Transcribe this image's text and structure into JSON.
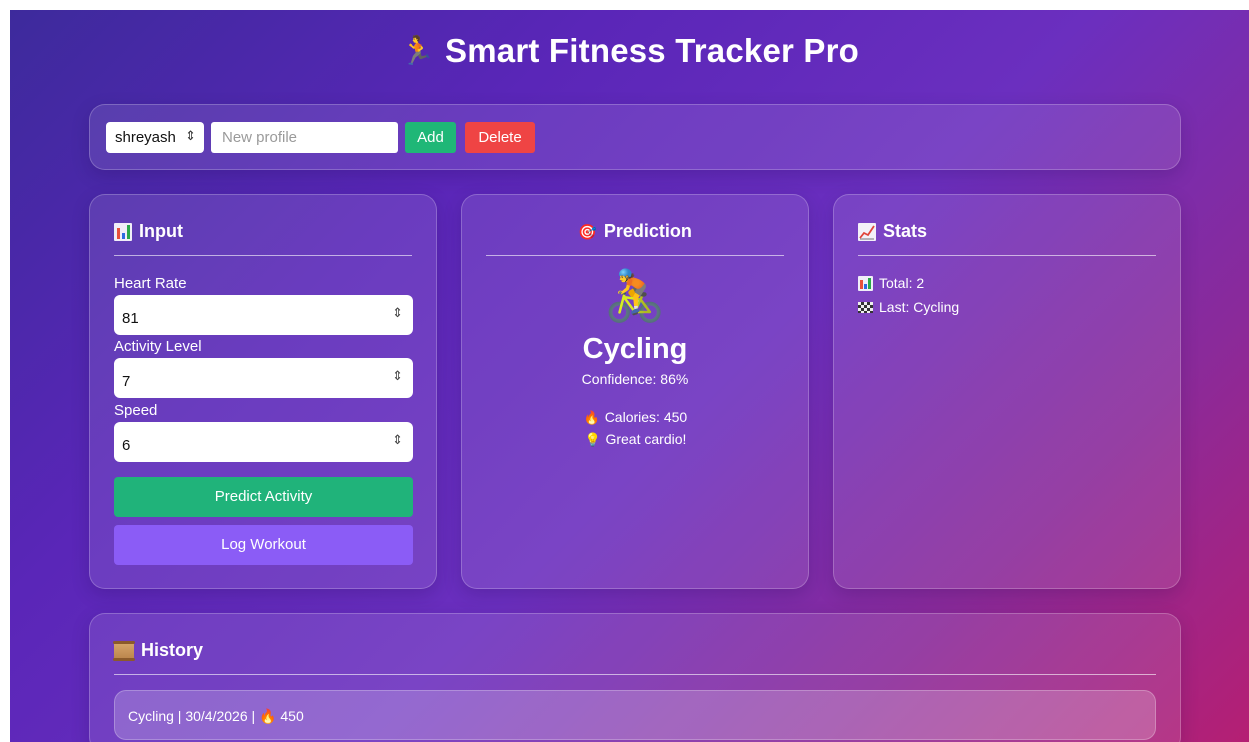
{
  "app": {
    "title": "Smart Fitness Tracker Pro",
    "title_icon": "🏃",
    "colors": {
      "gradient_start": "#3d2a9c",
      "gradient_end": "#b51f73",
      "green": "#1fb777",
      "red": "#ef4444",
      "purple": "#8b5cf6"
    }
  },
  "profile_bar": {
    "selected_profile": "shreyash",
    "new_profile_placeholder": "New profile",
    "new_profile_value": "",
    "add_label": "Add",
    "delete_label": "Delete"
  },
  "input": {
    "heading": "Input",
    "icon": "bar-chart-icon",
    "fields": [
      {
        "label": "Heart Rate",
        "value": "81"
      },
      {
        "label": "Activity Level",
        "value": "7"
      },
      {
        "label": "Speed",
        "value": "6"
      }
    ],
    "predict_label": "Predict Activity",
    "log_label": "Log Workout"
  },
  "prediction": {
    "heading": "Prediction",
    "heading_icon": "🎯",
    "activity_icon": "🚴",
    "activity": "Cycling",
    "confidence": "Confidence: 86%",
    "calories": "Calories: 450",
    "calories_icon": "🔥",
    "tip": "Great cardio!",
    "tip_icon": "💡"
  },
  "stats": {
    "heading": "Stats",
    "icon": "trend-chart-icon",
    "total": "Total: 2",
    "last": "Last: Cycling"
  },
  "history": {
    "heading": "History",
    "icon": "scroll-icon",
    "items": [
      {
        "activity": "Cycling",
        "date": "30/4/2026",
        "calories": "450",
        "fire_icon": "🔥"
      }
    ]
  }
}
